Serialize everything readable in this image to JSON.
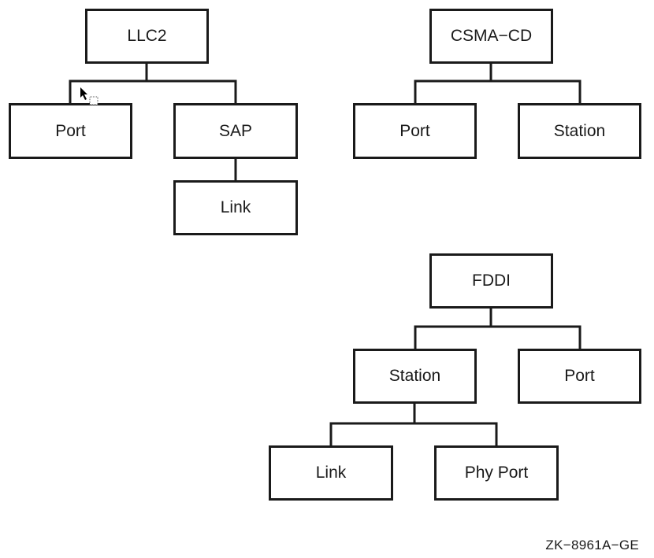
{
  "diagrams": [
    {
      "name": "llc2-tree",
      "root": "LLC2",
      "children": [
        {
          "label": "Port"
        },
        {
          "label": "SAP",
          "children": [
            {
              "label": "Link"
            }
          ]
        }
      ]
    },
    {
      "name": "csma-cd-tree",
      "root": "CSMA−CD",
      "children": [
        {
          "label": "Port"
        },
        {
          "label": "Station"
        }
      ]
    },
    {
      "name": "fddi-tree",
      "root": "FDDI",
      "children": [
        {
          "label": "Station",
          "children": [
            {
              "label": "Link"
            },
            {
              "label": "Phy Port"
            }
          ]
        },
        {
          "label": "Port"
        }
      ]
    }
  ],
  "labels": {
    "llc2": "LLC2",
    "llc2_port": "Port",
    "llc2_sap": "SAP",
    "llc2_link": "Link",
    "csma": "CSMA−CD",
    "csma_port": "Port",
    "csma_station": "Station",
    "fddi": "FDDI",
    "fddi_station": "Station",
    "fddi_port": "Port",
    "fddi_link": "Link",
    "fddi_phyport": "Phy Port"
  },
  "caption": "ZK−8961A−GE",
  "cursor_icon": "arrow-pointer-with-drag-box"
}
